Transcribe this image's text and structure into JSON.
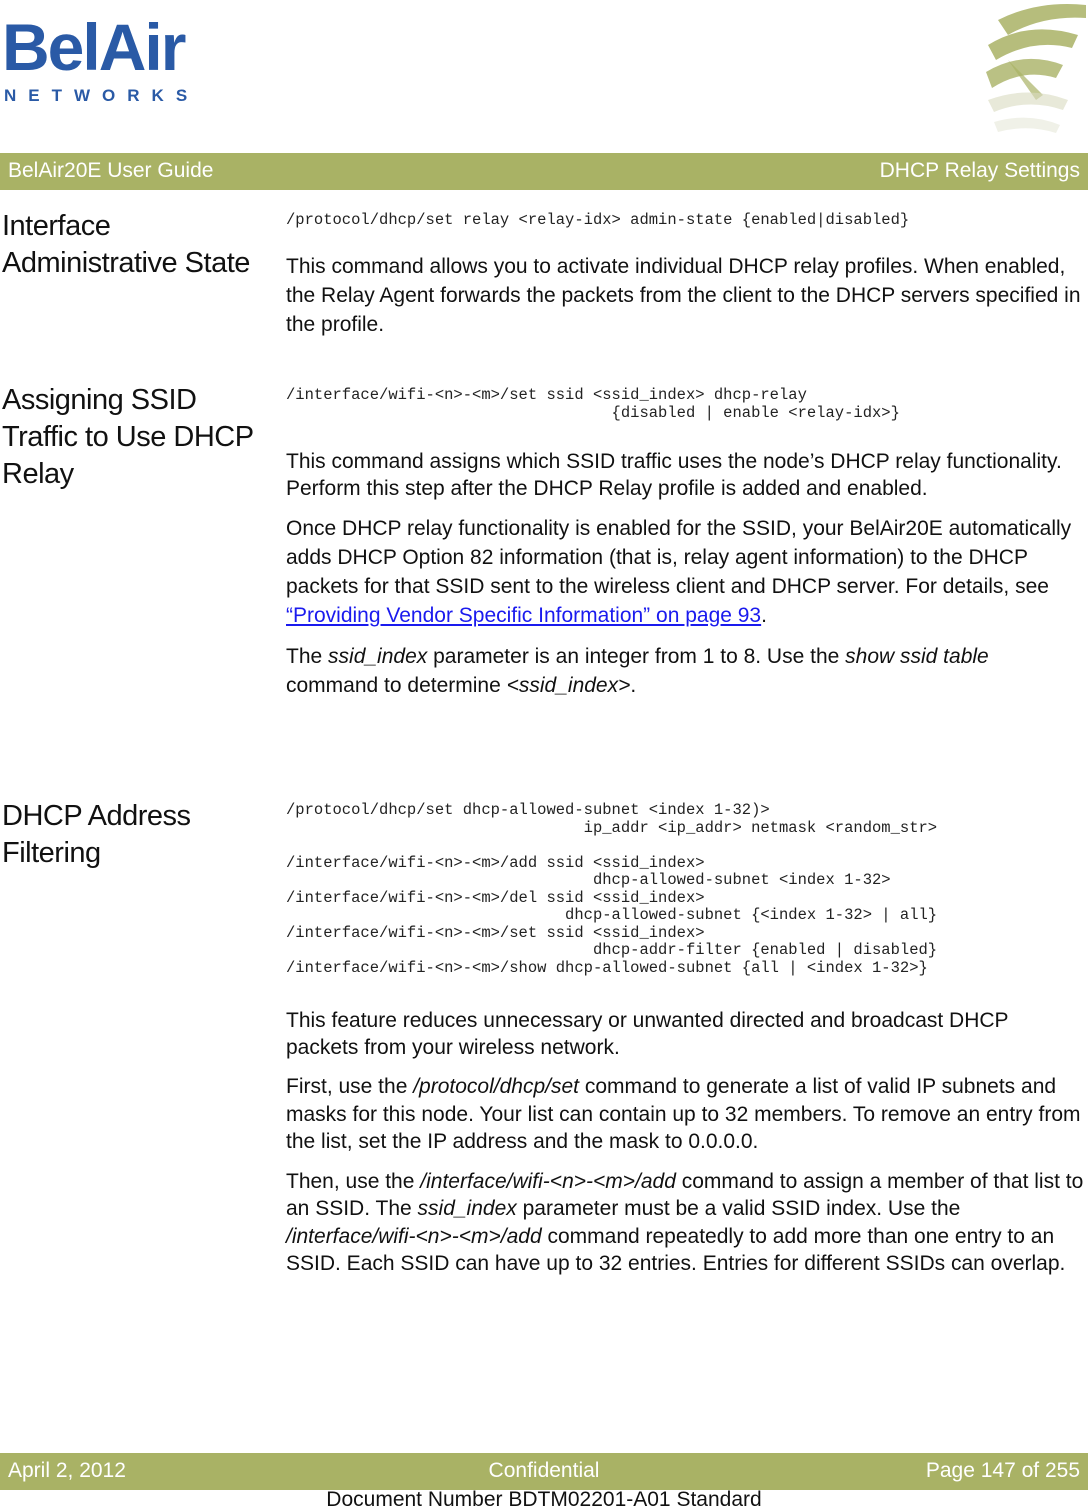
{
  "logo": {
    "brand": "BelAir",
    "subtitle": "NETWORKS"
  },
  "colors": {
    "brand_blue": "#2a5aa6",
    "bar_green": "#a9b265",
    "link_blue": "#1a1aee"
  },
  "header": {
    "guide_title": "BelAir20E User Guide",
    "chapter_title": "DHCP Relay Settings"
  },
  "sections": [
    {
      "title": "Interface Administrative State",
      "code": "/protocol/dhcp/set relay <relay-idx> admin-state {enabled|disabled}",
      "paragraphs": [
        "This command allows you to activate individual DHCP relay profiles. When enabled, the Relay Agent forwards the packets from the client to the DHCP servers specified in the profile."
      ]
    },
    {
      "title": "Assigning SSID Traffic to Use DHCP Relay",
      "code": "/interface/wifi-<n>-<m>/set ssid <ssid_index> dhcp-relay\n                                   {disabled | enable <relay-idx>}",
      "paragraphs": [
        "This command assigns which SSID traffic uses the node’s DHCP relay functionality. Perform this step after the DHCP Relay profile is added and enabled."
      ],
      "para2": {
        "text_before": "Once DHCP relay functionality is enabled for the SSID, your BelAir20E automatically adds DHCP Option 82 information (that is, relay agent information) to the DHCP packets for that SSID sent to the wireless client and DHCP server. For details, see ",
        "link": "“Providing Vendor Specific Information” on page 93",
        "text_after": "."
      },
      "para3": {
        "t1": "The ",
        "i1": "ssid_index",
        "t2": " parameter is an integer from 1 to 8. Use the ",
        "i2": "show ssid table",
        "t3": " command to determine ",
        "i3": "<ssid_index>",
        "t4": "."
      }
    },
    {
      "title": "DHCP Address Filtering",
      "code": "/protocol/dhcp/set dhcp-allowed-subnet <index 1-32)>\n                                ip_addr <ip_addr> netmask <random_str>\n\n/interface/wifi-<n>-<m>/add ssid <ssid_index>\n                                 dhcp-allowed-subnet <index 1-32>\n/interface/wifi-<n>-<m>/del ssid <ssid_index>\n                              dhcp-allowed-subnet {<index 1-32> | all}\n/interface/wifi-<n>-<m>/set ssid <ssid_index>\n                                 dhcp-addr-filter {enabled | disabled}\n/interface/wifi-<n>-<m>/show dhcp-allowed-subnet {all | <index 1-32>}",
      "para1": "This feature reduces unnecessary or unwanted directed and broadcast DHCP packets from your wireless network.",
      "para2": {
        "t1": "First, use the ",
        "i1": "/protocol/dhcp/set",
        "t2": " command to generate a list of valid IP subnets and masks for this node. Your list can contain up to 32 members. To remove an entry from the list, set the IP address and the mask to 0.0.0.0."
      },
      "para3": {
        "t1": "Then, use the ",
        "i1": "/interface/wifi-<n>-<m>/add",
        "t2": " command to assign a member of that list to an SSID. The ",
        "i2": "ssid_index",
        "t3": " parameter must be a valid SSID index. Use the ",
        "i3": "/interface/wifi-<n>-<m>/add",
        "t4": " command repeatedly to add more than one entry to an SSID. Each SSID can have up to 32 entries. Entries for different SSIDs can overlap."
      }
    }
  ],
  "footer": {
    "date": "April 2, 2012",
    "classification": "Confidential",
    "page": "Page 147 of 255",
    "document_number": "Document Number BDTM02201-A01 Standard"
  }
}
